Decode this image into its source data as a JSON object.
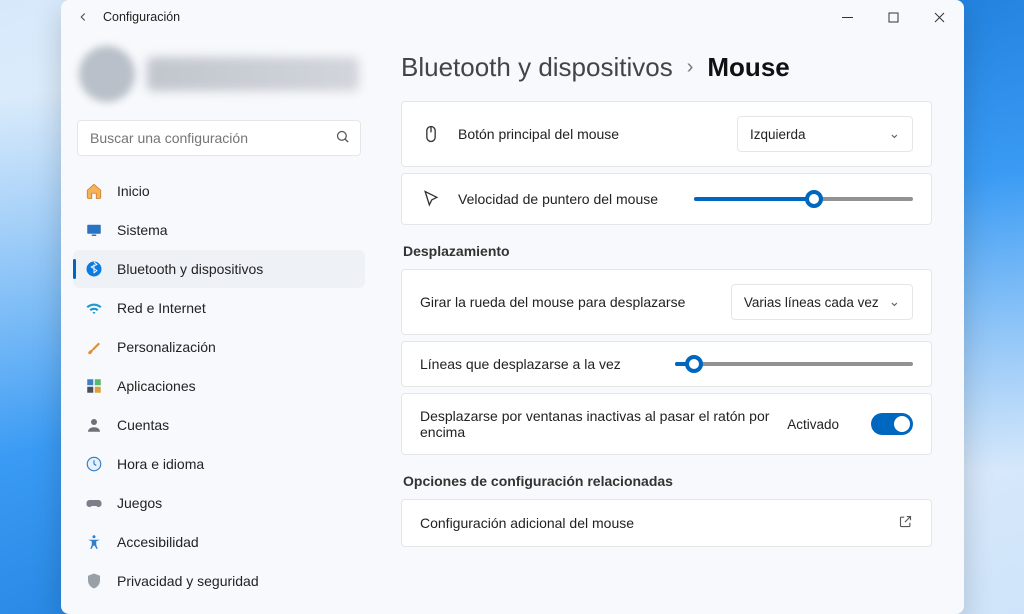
{
  "window": {
    "title": "Configuración"
  },
  "search": {
    "placeholder": "Buscar una configuración"
  },
  "sidebar": {
    "items": [
      {
        "label": "Inicio"
      },
      {
        "label": "Sistema"
      },
      {
        "label": "Bluetooth y dispositivos"
      },
      {
        "label": "Red e Internet"
      },
      {
        "label": "Personalización"
      },
      {
        "label": "Aplicaciones"
      },
      {
        "label": "Cuentas"
      },
      {
        "label": "Hora e idioma"
      },
      {
        "label": "Juegos"
      },
      {
        "label": "Accesibilidad"
      },
      {
        "label": "Privacidad y seguridad"
      }
    ]
  },
  "breadcrumb": {
    "parent": "Bluetooth y dispositivos",
    "current": "Mouse"
  },
  "main": {
    "primary_button": {
      "label": "Botón principal del mouse",
      "value": "Izquierda"
    },
    "pointer_speed": {
      "label": "Velocidad de puntero del mouse",
      "value_pct": 55
    },
    "scrolling_title": "Desplazamiento",
    "scroll_mode": {
      "label": "Girar la rueda del mouse para desplazarse",
      "value": "Varias líneas cada vez"
    },
    "lines_at_time": {
      "label": "Líneas que desplazarse a la vez",
      "value_pct": 8
    },
    "inactive_scroll": {
      "label": "Desplazarse por ventanas inactivas al pasar el ratón por encima",
      "state": "Activado"
    },
    "related_title": "Opciones de configuración relacionadas",
    "additional": {
      "label": "Configuración adicional del mouse"
    }
  }
}
